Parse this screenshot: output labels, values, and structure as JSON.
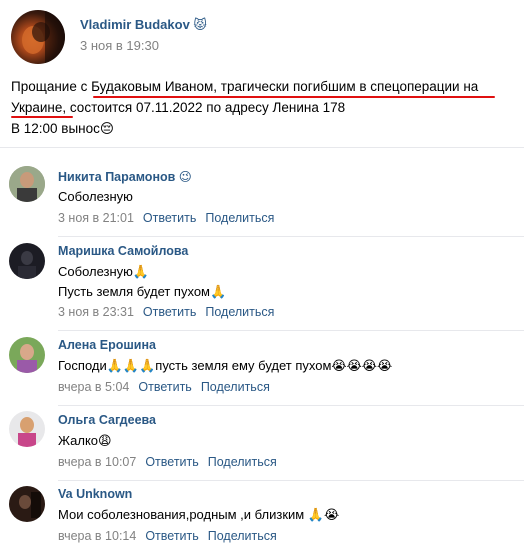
{
  "post": {
    "author": "Vladimir Budakov 😾",
    "date": "3 ноя в 19:30",
    "text_line1_a": "Прощание с ",
    "text_line1_b": "Будаковым Иваном, трагически погибшим в спецоперации на",
    "text_line2_a": "Украине,",
    "text_line2_b": " состоится 07.11.2022 по адресу Ленина 178",
    "text_line3": "В 12:00 вынос😔"
  },
  "comments": [
    {
      "name": "Никита Парамонов 😉",
      "lines": [
        "Соболезную"
      ],
      "time": "3 ноя в 21:01",
      "reply": "Ответить",
      "share": "Поделиться",
      "avatar_color": "#7a8c6a"
    },
    {
      "name": "Маришка Самойлова",
      "lines": [
        "Соболезную🙏",
        "Пусть земля будет пухом🙏"
      ],
      "time": "3 ноя в 23:31",
      "reply": "Ответить",
      "share": "Поделиться",
      "avatar_color": "#1c1c24"
    },
    {
      "name": "Алена Ерошина",
      "lines": [
        "Господи🙏🙏🙏пусть земля ему будет пухом😭😭😭😭"
      ],
      "time": "вчера в 5:04",
      "reply": "Ответить",
      "share": "Поделиться",
      "avatar_color": "#6a9a4a"
    },
    {
      "name": "Ольга Сагдеева",
      "lines": [
        "Жалко😩"
      ],
      "time": "вчера в 10:07",
      "reply": "Ответить",
      "share": "Поделиться",
      "avatar_color": "#c8468a"
    },
    {
      "name": "Va Unknown",
      "lines": [
        "Мои соболезнования,родным ,и близким 🙏😭"
      ],
      "time": "вчера в 10:14",
      "reply": "Ответить",
      "share": "Поделиться",
      "avatar_color": "#2a1a14"
    }
  ],
  "colors": {
    "link": "#2a5885",
    "meta": "#828282",
    "underline": "#e01010"
  }
}
